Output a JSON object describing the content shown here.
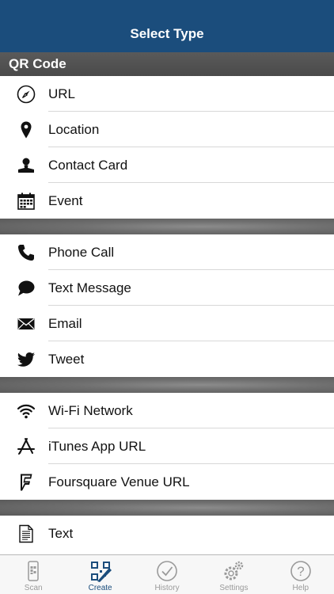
{
  "navbar": {
    "title": "Select Type"
  },
  "section": {
    "title": "QR Code"
  },
  "groups": [
    [
      {
        "label": "URL",
        "icon": "compass-icon"
      },
      {
        "label": "Location",
        "icon": "location-pin-icon"
      },
      {
        "label": "Contact Card",
        "icon": "person-icon"
      },
      {
        "label": "Event",
        "icon": "calendar-icon"
      }
    ],
    [
      {
        "label": "Phone Call",
        "icon": "phone-icon"
      },
      {
        "label": "Text Message",
        "icon": "speech-bubble-icon"
      },
      {
        "label": "Email",
        "icon": "envelope-icon"
      },
      {
        "label": "Tweet",
        "icon": "twitter-bird-icon"
      }
    ],
    [
      {
        "label": "Wi-Fi Network",
        "icon": "wifi-icon"
      },
      {
        "label": "iTunes App URL",
        "icon": "app-store-icon"
      },
      {
        "label": "Foursquare Venue URL",
        "icon": "foursquare-icon"
      }
    ],
    [
      {
        "label": "Text",
        "icon": "document-icon"
      }
    ]
  ],
  "tabs": [
    {
      "label": "Scan",
      "icon": "qr-scan-icon",
      "active": false
    },
    {
      "label": "Create",
      "icon": "qr-create-icon",
      "active": true
    },
    {
      "label": "History",
      "icon": "checkmark-circle-icon",
      "active": false
    },
    {
      "label": "Settings",
      "icon": "gears-icon",
      "active": false
    },
    {
      "label": "Help",
      "icon": "question-circle-icon",
      "active": false
    }
  ],
  "colors": {
    "navbar": "#1b4d7c",
    "active_tab": "#1b4d7c",
    "inactive_tab": "#9a9a9a"
  }
}
